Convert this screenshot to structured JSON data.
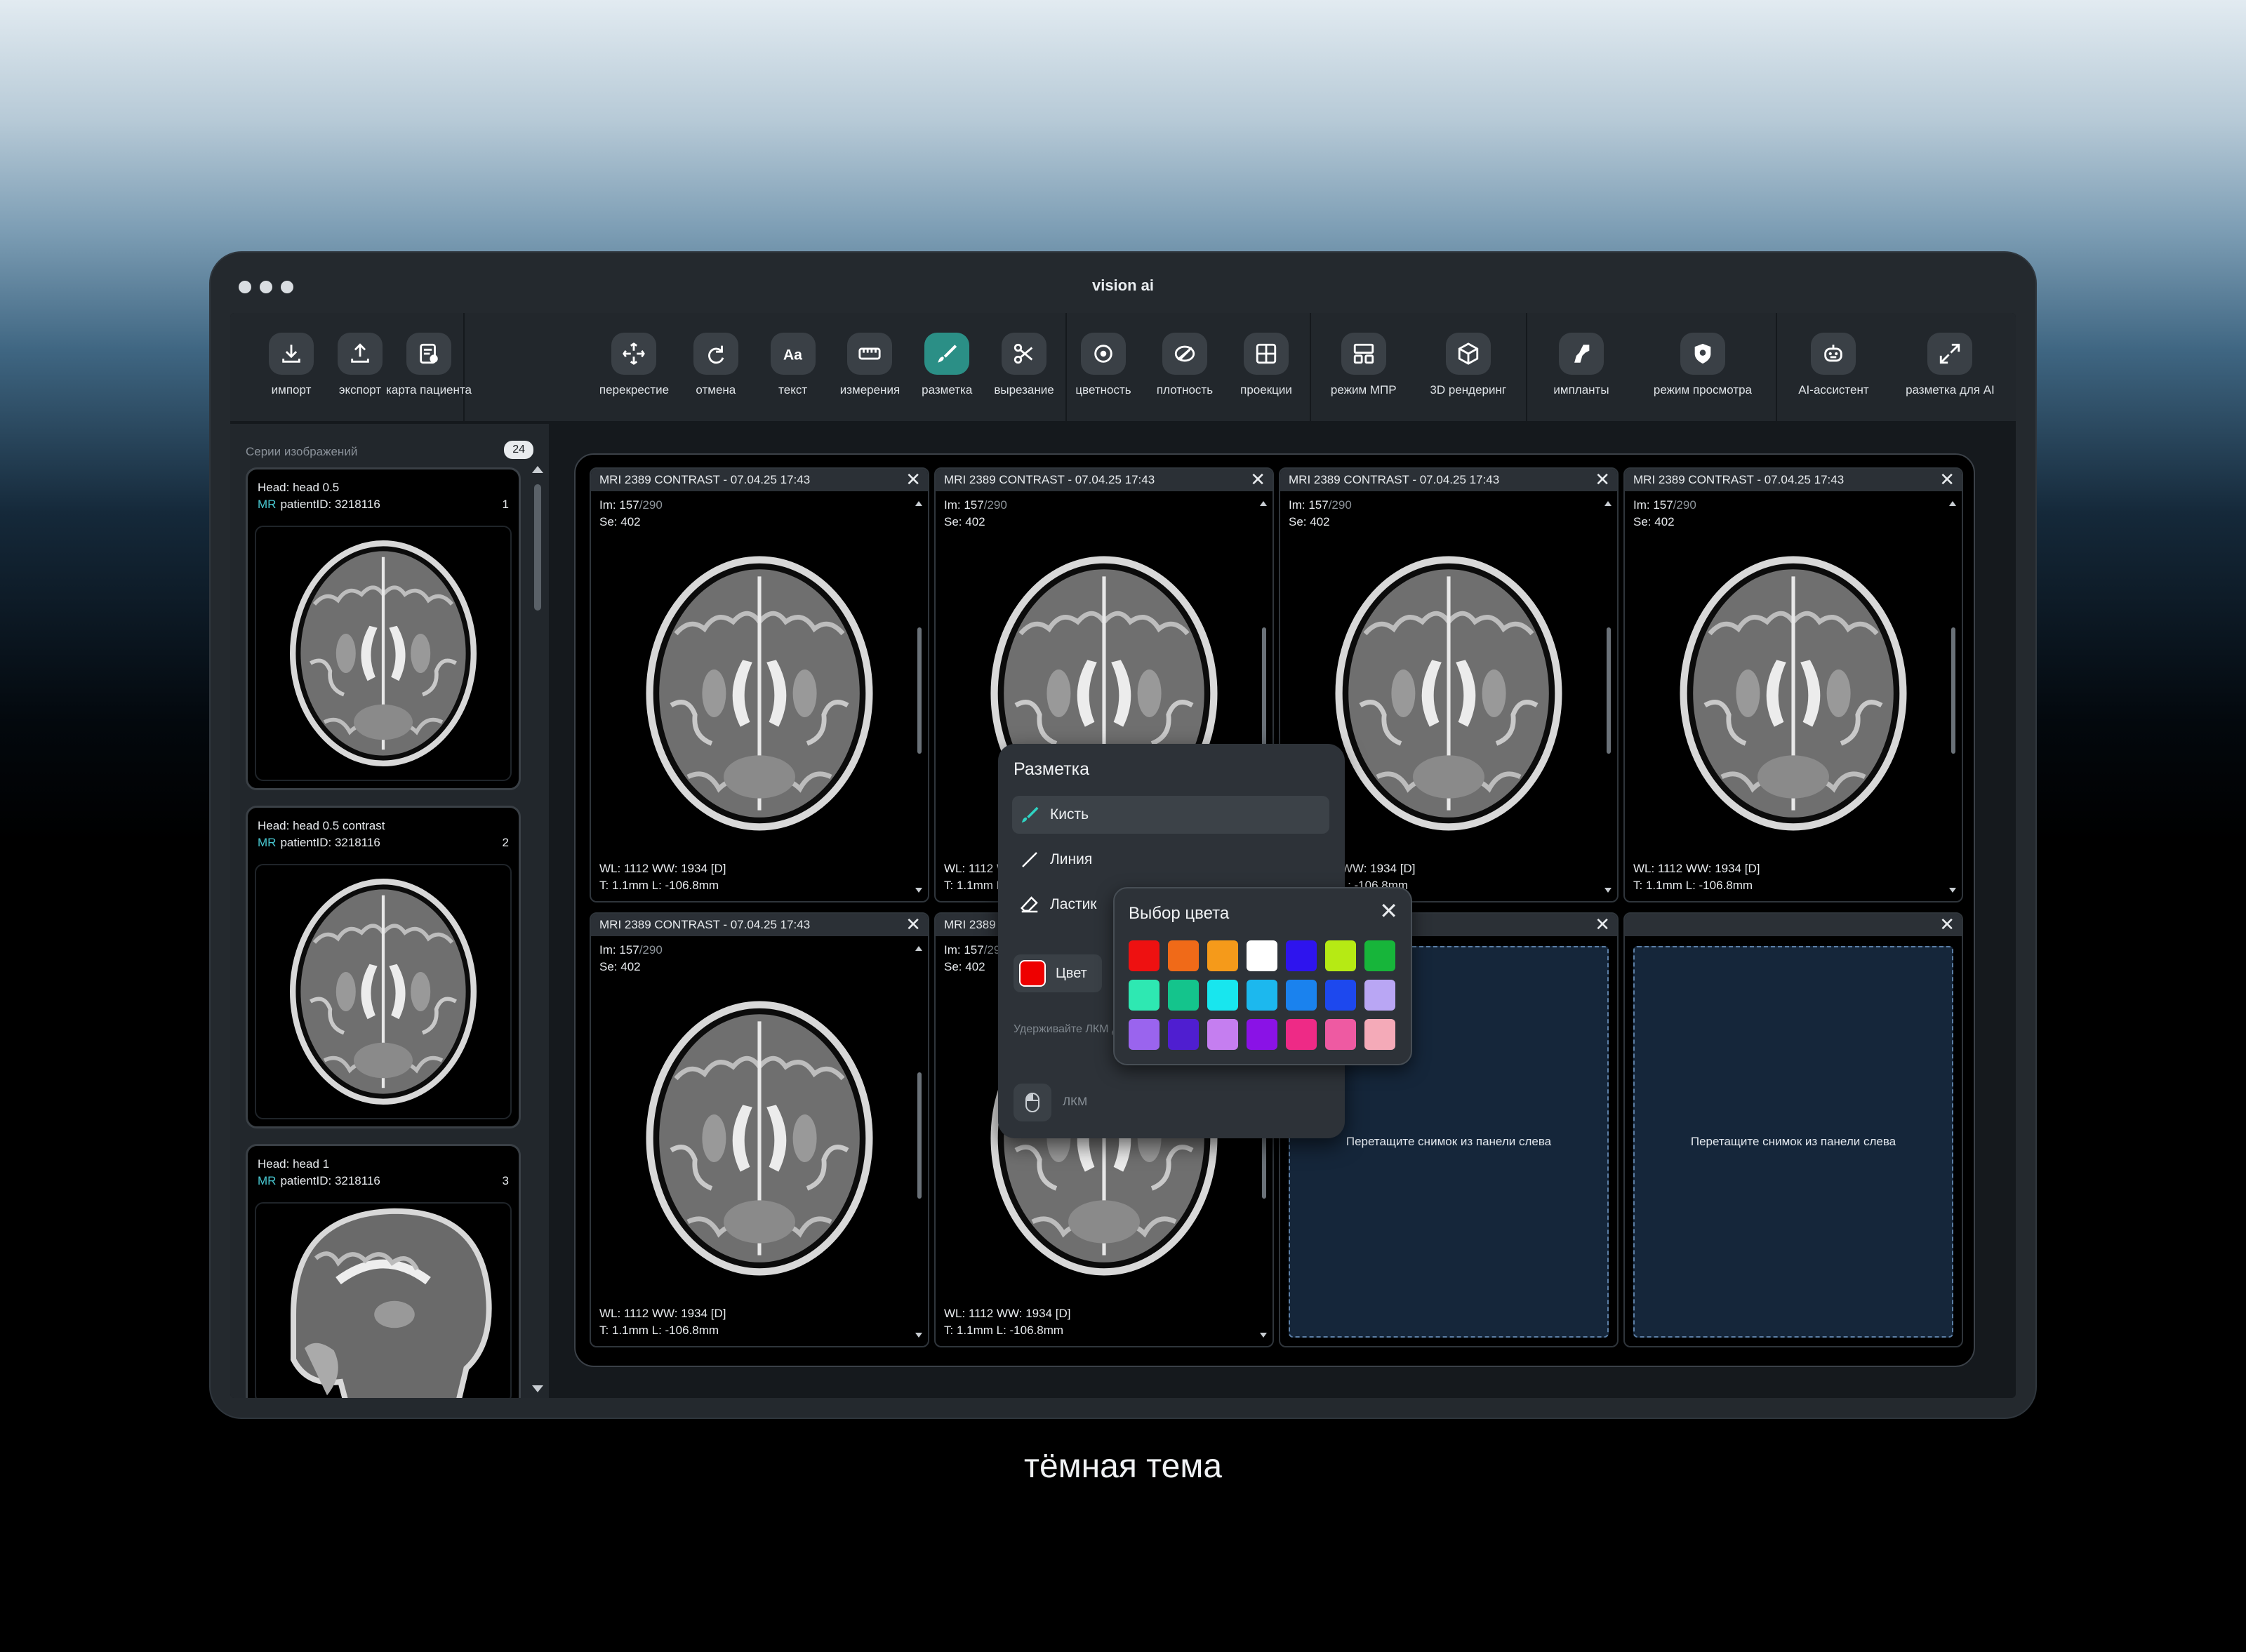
{
  "window": {
    "title": "vision ai"
  },
  "toolbar": {
    "groups": [
      [
        {
          "label": "импорт",
          "icon": "download-icon"
        },
        {
          "label": "экспорт",
          "icon": "upload-icon"
        },
        {
          "label": "карта пациента",
          "icon": "patient-card-icon"
        }
      ],
      [
        {
          "label": "перекрестие",
          "icon": "crosshair-icon"
        },
        {
          "label": "отмена",
          "icon": "redo-icon"
        },
        {
          "label": "текст",
          "icon": "text-icon",
          "glyph": "Aa"
        },
        {
          "label": "измерения",
          "icon": "ruler-icon"
        },
        {
          "label": "разметка",
          "icon": "brush-icon",
          "active": true
        },
        {
          "label": "вырезание",
          "icon": "scissors-icon"
        }
      ],
      [
        {
          "label": "цветность",
          "icon": "color-icon"
        },
        {
          "label": "плотность",
          "icon": "density-icon"
        },
        {
          "label": "проекции",
          "icon": "grid-icon"
        }
      ],
      [
        {
          "label": "режим МПР",
          "icon": "mpr-layout-icon"
        },
        {
          "label": "3D рендеринг",
          "icon": "cube-icon"
        }
      ],
      [
        {
          "label": "импланты",
          "icon": "implant-icon"
        },
        {
          "label": "режим просмотра",
          "icon": "view-mode-icon"
        }
      ],
      [
        {
          "label": "AI-ассистент",
          "icon": "robot-icon"
        },
        {
          "label": "разметка для AI",
          "icon": "expand-icon"
        }
      ]
    ]
  },
  "sidebar": {
    "title": "Серии изображений",
    "count": "24",
    "series": [
      {
        "line1": "Head:  head 0.5",
        "modality": "MR",
        "line2": "patientID: 3218116",
        "number": "1",
        "view": "axial"
      },
      {
        "line1": "Head:  head 0.5 contrast",
        "modality": "MR",
        "line2": "patientID: 3218116",
        "number": "2",
        "view": "axial"
      },
      {
        "line1": "Head:  head 1",
        "modality": "MR",
        "line2": "patientID: 3218116",
        "number": "3",
        "view": "sagittal"
      }
    ]
  },
  "viewer": {
    "panes": [
      {
        "title": "MRI 2389 CONTRAST - 07.04.25 17:43",
        "im": "Im: 157",
        "im_total": "/290",
        "se": "Se: 402",
        "wl": "WL: 1112    WW: 1934 [D]",
        "t": "T: 1.1mm    L: -106.8mm",
        "empty": false
      },
      {
        "title": "MRI 2389 CONTRAST - 07.04.25 17:43",
        "im": "Im: 157",
        "im_total": "/290",
        "se": "Se: 402",
        "wl": "WL: 1112    WW: 1934 [D]",
        "t": "T: 1.1mm    L: -106.8mm",
        "empty": false
      },
      {
        "title": "MRI 2389 CONTRAST - 07.04.25 17:43",
        "im": "Im: 157",
        "im_total": "/290",
        "se": "Se: 402",
        "wl": "WL: 1112    WW: 1934 [D]",
        "t": "T: 1.1mm    L: -106.8mm",
        "empty": false
      },
      {
        "title": "MRI 2389 CONTRAST - 07.04.25 17:43",
        "im": "Im: 157",
        "im_total": "/290",
        "se": "Se: 402",
        "wl": "WL: 1112    WW: 1934 [D]",
        "t": "T: 1.1mm    L: -106.8mm",
        "empty": false
      },
      {
        "title": "MRI 2389 CONTRAST - 07.04.25 17:43",
        "im": "Im: 157",
        "im_total": "/290",
        "se": "Se: 402",
        "wl": "WL: 1112    WW: 1934 [D]",
        "t": "T: 1.1mm    L: -106.8mm",
        "empty": false
      },
      {
        "title": "MRI 2389 CONTRAST - 07.04.25 17:43",
        "im": "Im: 157",
        "im_total": "/290",
        "se": "Se: 402",
        "wl": "WL: 1112    WW: 1934 [D]",
        "t": "T: 1.1mm    L: -106.8mm",
        "empty": false
      },
      {
        "title": "",
        "empty": true,
        "drop_text": "Перетащите снимок из панели слева"
      },
      {
        "title": "",
        "empty": true,
        "drop_text": "Перетащите снимок из панели слева"
      }
    ]
  },
  "markup_menu": {
    "title": "Разметка",
    "tools": [
      {
        "label": "Кисть",
        "icon": "brush-icon",
        "selected": true
      },
      {
        "label": "Линия",
        "icon": "line-icon"
      },
      {
        "label": "Ластик",
        "icon": "eraser-icon"
      }
    ],
    "color_label": "Цвет",
    "current_color": "#ee0000",
    "hint": "Удерживайте ЛКМ для рисования. Ш прямые линии",
    "mouse_label": "ЛКМ"
  },
  "color_picker": {
    "title": "Выбор цвета",
    "colors": [
      "#ee1111",
      "#f06a18",
      "#f59a1a",
      "#ffffff",
      "#2e14ee",
      "#b6ea14",
      "#17b53a",
      "#2ee8b2",
      "#14c48c",
      "#18e6ee",
      "#1cb8ee",
      "#1a82ee",
      "#1d48ee",
      "#b9a6f4",
      "#9a64ee",
      "#4f1ed0",
      "#c57ef0",
      "#8a12e6",
      "#ee2a86",
      "#ee5aa2",
      "#f4aab8"
    ]
  },
  "caption": "тёмная тема",
  "colors": {
    "accent": "#2b8f86",
    "panel": "#22272c",
    "background": "#15191d"
  }
}
